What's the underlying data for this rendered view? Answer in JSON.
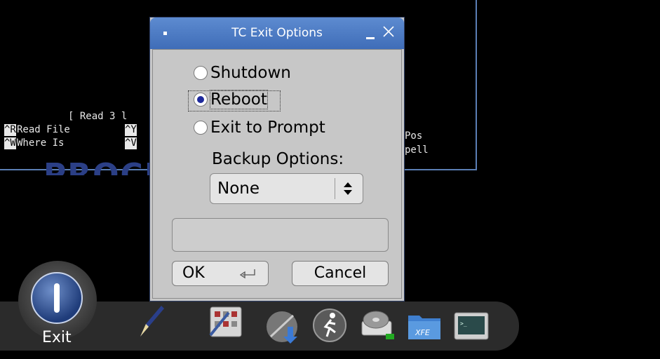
{
  "terminal": {
    "status_line": "[ Read 3 l",
    "shortcut_row1_key1": "^R",
    "shortcut_row1_label1": "Read File",
    "shortcut_row1_key2": "^Y",
    "shortcut_row1_tail": "Pos",
    "shortcut_row2_key1": "^W",
    "shortcut_row2_label1": "Where Is",
    "shortcut_row2_key2": "^V",
    "shortcut_row2_tail": "pell",
    "background_word": "PROCE"
  },
  "dialog": {
    "title": "TC Exit Options",
    "options": [
      {
        "label": "Shutdown",
        "selected": false
      },
      {
        "label": "Reboot",
        "selected": true
      },
      {
        "label": "Exit to Prompt",
        "selected": false
      }
    ],
    "backup_label": "Backup Options:",
    "backup_value": "None",
    "status_text": "",
    "ok_label": "OK",
    "cancel_label": "Cancel"
  },
  "taskbar": {
    "exit_label": "Exit",
    "icons": [
      "pen-icon",
      "control-panel-icon",
      "install-icon",
      "run-icon",
      "mount-tool-icon",
      "xfe-file-manager-icon",
      "terminal-icon"
    ],
    "xfe_text": "XFE"
  },
  "colors": {
    "titlebar": "#4a78c2",
    "dialog_bg": "#c7c7c7",
    "radio_selected": "#1e2a9c",
    "terminal_border": "#5b7fb5"
  }
}
